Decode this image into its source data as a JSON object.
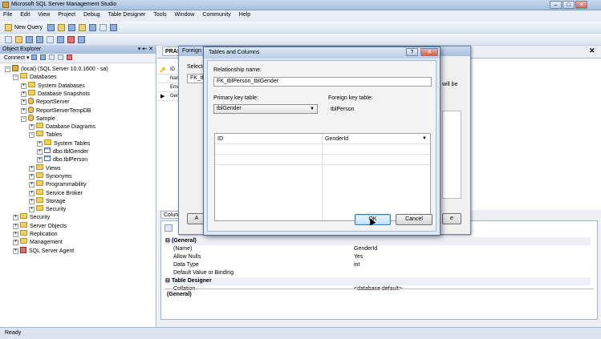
{
  "window": {
    "title": "Microsoft SQL Server Management Studio",
    "controls": [
      "–",
      "□",
      "✕"
    ]
  },
  "menu": [
    "File",
    "Edit",
    "View",
    "Project",
    "Debug",
    "Table Designer",
    "Tools",
    "Window",
    "Community",
    "Help"
  ],
  "toolbar": {
    "new_query": "New Query"
  },
  "object_explorer": {
    "title": "Object Explorer",
    "pin": "▾ ⇤ ✕",
    "connect": "Connect ▾",
    "tree": [
      {
        "label": "(local) (SQL Server 10.0.1600 - sa)",
        "level": 0,
        "exp": "−",
        "icon": "server"
      },
      {
        "label": "Databases",
        "level": 1,
        "exp": "−",
        "icon": "folder"
      },
      {
        "label": "System Databases",
        "level": 2,
        "exp": "+",
        "icon": "folder"
      },
      {
        "label": "Database Snapshots",
        "level": 2,
        "exp": "+",
        "icon": "folder"
      },
      {
        "label": "ReportServer",
        "level": 2,
        "exp": "+",
        "icon": "db"
      },
      {
        "label": "ReportServerTempDB",
        "level": 2,
        "exp": "+",
        "icon": "db"
      },
      {
        "label": "Sample",
        "level": 2,
        "exp": "−",
        "icon": "db"
      },
      {
        "label": "Database Diagrams",
        "level": 3,
        "exp": "+",
        "icon": "folder"
      },
      {
        "label": "Tables",
        "level": 3,
        "exp": "−",
        "icon": "folder"
      },
      {
        "label": "System Tables",
        "level": 4,
        "exp": "+",
        "icon": "folder"
      },
      {
        "label": "dbo.tblGender",
        "level": 4,
        "exp": "+",
        "icon": "table"
      },
      {
        "label": "dbo.tblPerson",
        "level": 4,
        "exp": "+",
        "icon": "table"
      },
      {
        "label": "Views",
        "level": 3,
        "exp": "+",
        "icon": "folder"
      },
      {
        "label": "Synonyms",
        "level": 3,
        "exp": "+",
        "icon": "folder"
      },
      {
        "label": "Programmability",
        "level": 3,
        "exp": "+",
        "icon": "folder"
      },
      {
        "label": "Service Broker",
        "level": 3,
        "exp": "+",
        "icon": "folder"
      },
      {
        "label": "Storage",
        "level": 3,
        "exp": "+",
        "icon": "folder"
      },
      {
        "label": "Security",
        "level": 3,
        "exp": "+",
        "icon": "folder"
      },
      {
        "label": "Security",
        "level": 1,
        "exp": "+",
        "icon": "folder"
      },
      {
        "label": "Server Objects",
        "level": 1,
        "exp": "+",
        "icon": "folder"
      },
      {
        "label": "Replication",
        "level": 1,
        "exp": "+",
        "icon": "folder"
      },
      {
        "label": "Management",
        "level": 1,
        "exp": "+",
        "icon": "folder"
      },
      {
        "label": "SQL Server Agent",
        "level": 1,
        "exp": "+",
        "icon": "agent"
      }
    ]
  },
  "document": {
    "tab": "PRAS",
    "rows": [
      "ID",
      "Nam",
      "Ema",
      "Gen"
    ],
    "column_props_tab": "Colun",
    "props": [
      {
        "name": "(General)",
        "value": "",
        "header": true
      },
      {
        "name": "(Name)",
        "value": "GenderId"
      },
      {
        "name": "Allow Nulls",
        "value": "Yes"
      },
      {
        "name": "Data Type",
        "value": "int"
      },
      {
        "name": "Default Value or Binding",
        "value": ""
      },
      {
        "name": "Table Designer",
        "value": "",
        "header": true
      },
      {
        "name": "Collation",
        "value": "<database default>"
      }
    ],
    "general_label": "(General)"
  },
  "fk_dialog": {
    "title": "Foreign K",
    "selected": "Selecte",
    "item": "FK_tbl",
    "side_text": "will be"
  },
  "tc_dialog": {
    "title": "Tables and Columns",
    "relationship_label": "Relationship name:",
    "relationship_value": "FK_tblPerson_tblGender",
    "pk_label": "Primary key table:",
    "fk_label": "Foreign key table:",
    "pk_table": "tblGender",
    "fk_table": "tblPerson",
    "pk_column": "ID",
    "fk_column": "GenderId",
    "ok": "OK",
    "cancel": "Cancel"
  },
  "status": "Ready"
}
